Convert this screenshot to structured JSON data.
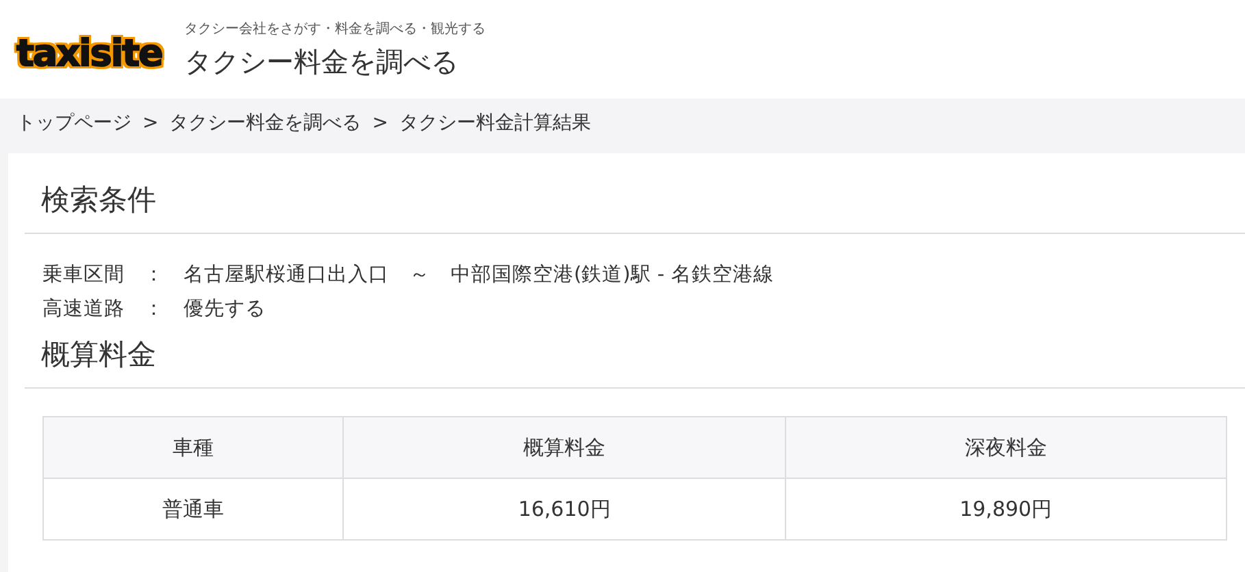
{
  "header": {
    "logo": "taxisite",
    "tagline": "タクシー会社をさがす・料金を調べる・観光する",
    "title": "タクシー料金を調べる"
  },
  "breadcrumb": [
    "トップページ",
    "タクシー料金を調べる",
    "タクシー料金計算結果"
  ],
  "breadcrumb_separator": ">",
  "conditions": {
    "heading": "検索条件",
    "rows": [
      {
        "label": "乗車区間",
        "value": "名古屋駅桜通口出入口　～　中部国際空港(鉄道)駅 - 名鉄空港線"
      },
      {
        "label": "高速道路",
        "value": "優先する"
      }
    ],
    "separator": "："
  },
  "fares": {
    "heading": "概算料金",
    "columns": [
      "車種",
      "概算料金",
      "深夜料金"
    ],
    "rows": [
      [
        "普通車",
        "16,610円",
        "19,890円"
      ]
    ]
  }
}
